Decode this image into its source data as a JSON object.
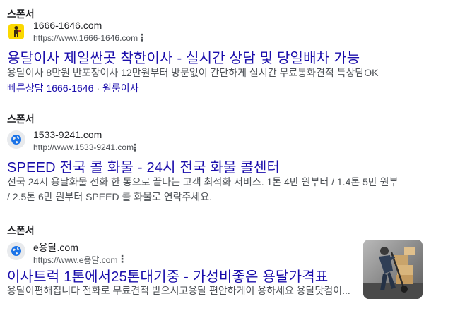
{
  "ads": [
    {
      "sponsor_label": "스폰서",
      "site_name": "1666-1646.com",
      "site_url": "https://www.1666-1646.com",
      "title": "용달이사 제일싼곳 착한이사 - 실시간 상담 및 당일배차 가능",
      "description": "용달이사 8만원 반포장이사 12만원부터 방문없이 간단하게 실시간 무료통화견적 특상담OK",
      "sitelinks": [
        "빠른상담 1666-1646",
        "원룸이사"
      ],
      "favicon": "mover-logo-icon"
    },
    {
      "sponsor_label": "스폰서",
      "site_name": "1533-9241.com",
      "site_url": "http://www.1533-9241.com",
      "title": "SPEED 전국 콜 화물 - 24시 전국 화물 콜센터",
      "description_lines": [
        "전국 24시 용달화물 전화 한 통으로 끝나는 고객 최적화 서비스. 1톤 4만 원부터 / 1.4톤 5만 원부",
        "/ 2.5톤 6만 원부터 SPEED 콜 화물로 연락주세요."
      ],
      "favicon": "globe-icon"
    },
    {
      "sponsor_label": "스폰서",
      "site_name": "e용달.com",
      "site_url": "https://www.e용달.com",
      "title": "이사트럭 1톤에서25톤대기중 - 가성비좋은 용달가격표",
      "description": "용달이편해집니다 전화로 무료견적 받으시고용달 편안하게이 용하세요 용달닷컴이...",
      "favicon": "globe-icon",
      "thumbnail": "worker-with-hand-truck-image"
    }
  ],
  "colors": {
    "title_link": "#1a0dab",
    "text": "#202124",
    "muted": "#4d5156"
  }
}
